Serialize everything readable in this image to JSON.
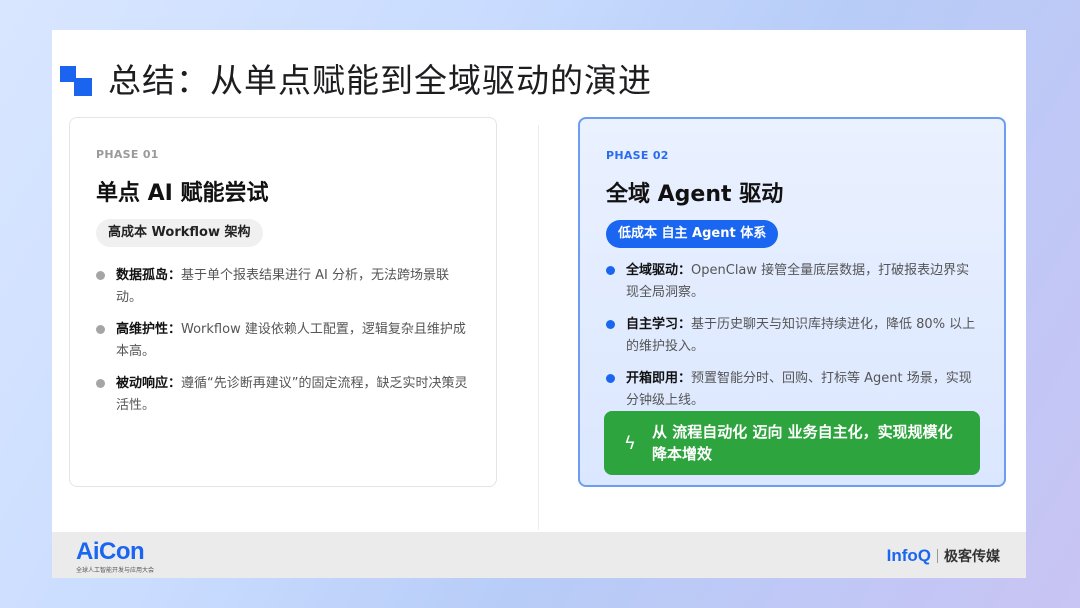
{
  "title": "总结：从单点赋能到全域驱动的演进",
  "phase1": {
    "label": "PHASE 01",
    "heading": "单点 AI 赋能尝试",
    "tag": "高成本 Workflow 架构",
    "items": [
      {
        "key": "数据孤岛：",
        "text": "基于单个报表结果进行 AI 分析，无法跨场景联动。"
      },
      {
        "key": "高维护性：",
        "text": "Workflow 建设依赖人工配置，逻辑复杂且维护成本高。"
      },
      {
        "key": "被动响应：",
        "text": "遵循“先诊断再建议”的固定流程，缺乏实时决策灵活性。"
      }
    ]
  },
  "phase2": {
    "label": "PHASE 02",
    "heading": "全域 Agent 驱动",
    "tag": "低成本 自主 Agent 体系",
    "items": [
      {
        "key": "全域驱动：",
        "text": "OpenClaw 接管全量底层数据，打破报表边界实现全局洞察。"
      },
      {
        "key": "自主学习：",
        "text": "基于历史聊天与知识库持续进化，降低 80% 以上的维护投入。"
      },
      {
        "key": "开箱即用：",
        "text": "预置智能分时、回购、打标等 Agent 场景，实现分钟级上线。"
      }
    ],
    "callout": "从 流程自动化 迈向 业务自主化，实现规模化降本增效"
  },
  "footer": {
    "brand": "AiCon",
    "brand_sub": "全球人工智能开发与应用大会",
    "partner": "InfoQ",
    "partner_cn": "极客传媒"
  },
  "colors": {
    "accent": "#1a66f0",
    "callout": "#2ea43f"
  }
}
